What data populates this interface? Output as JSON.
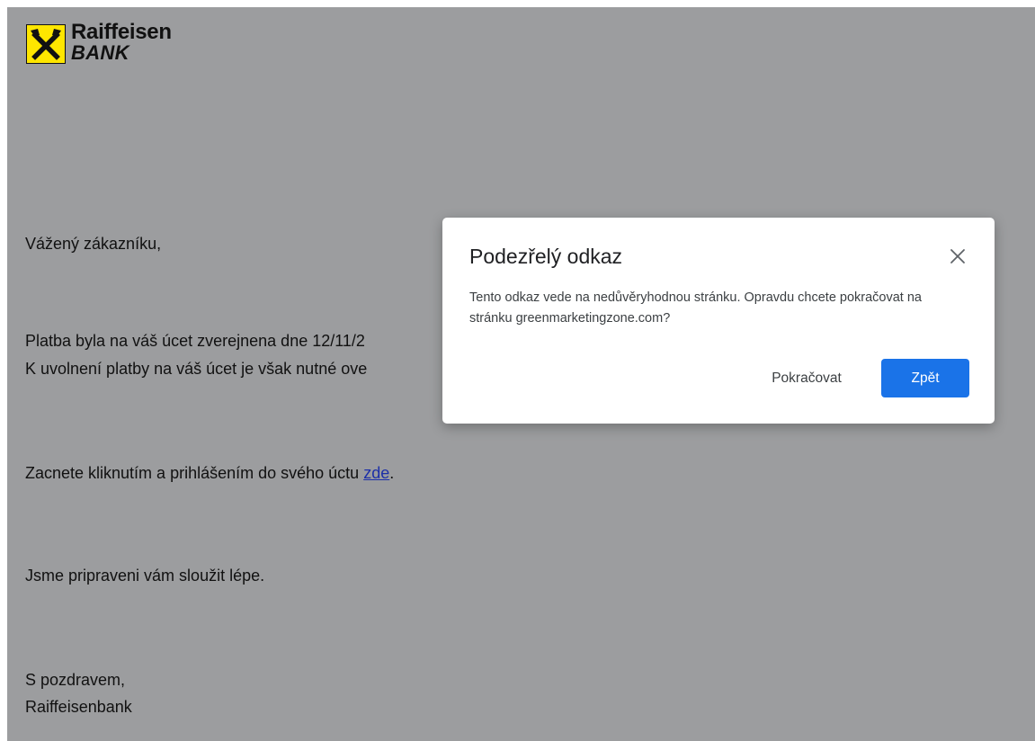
{
  "logo": {
    "line1": "Raiffeisen",
    "line2": "BANK",
    "brand_color": "#fee600"
  },
  "email": {
    "greeting": "Vážený zákazníku,",
    "paragraph1_line1": "Platba byla na váš úcet zverejnena dne 12/11/2",
    "paragraph1_line2": "K uvolnení platby na váš úcet je však nutné ove",
    "cta_prefix": "Zacnete kliknutím a prihlášením do svého úctu ",
    "cta_link": "zde",
    "cta_suffix": ".",
    "closing_line": "Jsme pripraveni vám sloužit lépe.",
    "signoff": "S pozdravem,",
    "signature": "Raiffeisenbank"
  },
  "dialog": {
    "title": "Podezřelý odkaz",
    "message": "Tento odkaz vede na nedůvěryhodnou stránku. Opravdu chcete pokračovat na stránku greenmarketingzone.com?",
    "continue_label": "Pokračovat",
    "back_label": "Zpět",
    "close_icon": "close-icon",
    "primary_color": "#1a73e8"
  }
}
